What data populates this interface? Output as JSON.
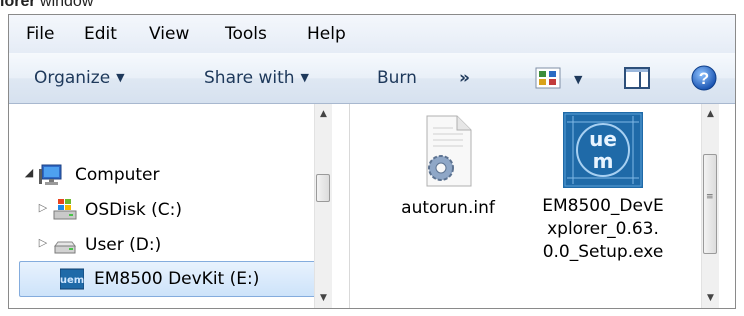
{
  "caption": {
    "bold": "lorer",
    "rest": " window"
  },
  "menubar": {
    "items": [
      "File",
      "Edit",
      "View",
      "Tools",
      "Help"
    ]
  },
  "toolbar": {
    "organize": "Organize",
    "share_with": "Share with",
    "burn": "Burn",
    "more": "»",
    "help_glyph": "?"
  },
  "nav": {
    "items": [
      {
        "label": "Computer",
        "icon": "computer-icon",
        "expanded": true
      },
      {
        "label": "OSDisk (C:)",
        "icon": "windows-drive-icon",
        "expanded": false
      },
      {
        "label": "User (D:)",
        "icon": "hard-drive-icon",
        "expanded": false
      },
      {
        "label": "EM8500 DevKit (E:)",
        "icon": "em-drive-icon",
        "selected": true
      }
    ]
  },
  "files": [
    {
      "name": "autorun.inf",
      "icon": "inf-file-icon"
    },
    {
      "name": "EM8500_DevExplorer_0.63.0.0_Setup.exe",
      "icon": "em-setup-icon"
    }
  ],
  "colors": {
    "selection": "#cde3fa",
    "toolbar_text": "#1e395b",
    "help": "#1f6fce"
  }
}
